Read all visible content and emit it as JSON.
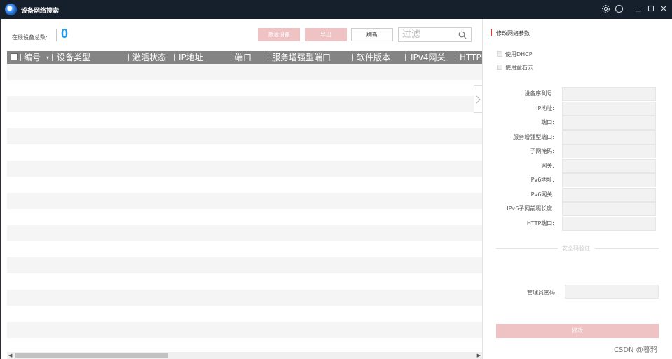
{
  "window": {
    "title": "设备网络搜索"
  },
  "toolbar": {
    "online_label": "在线设备总数:",
    "online_count": "0",
    "activate_label": "激活设备",
    "export_label": "导出",
    "refresh_label": "刷新",
    "search_placeholder": "过滤"
  },
  "table": {
    "columns": [
      "编号",
      "设备类型",
      "激活状态",
      "IP地址",
      "端口",
      "服务增强型端口",
      "软件版本",
      "IPv4网关",
      "HTTP端"
    ],
    "row_count": 18
  },
  "panel": {
    "title": "修改网络参数",
    "use_dhcp": "使用DHCP",
    "use_ezviz": "使用萤石云",
    "fields": [
      "设备序列号:",
      "IP地址:",
      "端口:",
      "服务增强型端口:",
      "子网掩码:",
      "网关:",
      "IPv6地址:",
      "IPv6网关:",
      "IPv6子网前缀长度:",
      "HTTP端口:"
    ],
    "security_label": "安全码验证",
    "admin_password_label": "管理员密码:",
    "modify_label": "修改"
  },
  "watermark": "CSDN @暮鸦",
  "colors": {
    "titlebar": "#16202c",
    "accent_blue": "#1e9bf0",
    "disabled_button": "#efc2c4",
    "header_gray": "#848484",
    "row_stripe": "#f5f5f5",
    "panel_mark": "#d43b3b"
  }
}
